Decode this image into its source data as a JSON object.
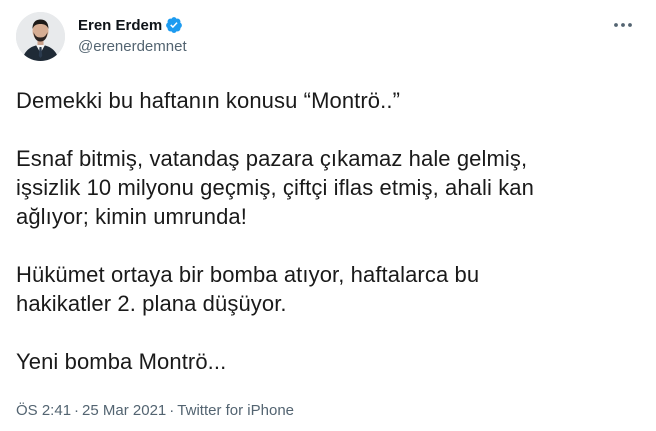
{
  "author": {
    "display_name": "Eren Erdem",
    "handle": "@erenerdemnet",
    "verified": true,
    "avatar_icon": "profile-photo-avatar"
  },
  "tweet": {
    "paragraphs": [
      "Demekki bu haftanın konusu “Montrö..”",
      "Esnaf bitmiş, vatandaş pazara çıkamaz hale gelmiş,\nişsizlik 10 milyonu geçmiş, çiftçi iflas etmiş, ahali kan\nağlıyor; kimin umrunda!",
      "Hükümet ortaya bir bomba atıyor, haftalarca bu\nhakikatler 2. plana düşüyor.",
      "Yeni bomba Montrö..."
    ]
  },
  "meta": {
    "time": "ÖS 2:41",
    "date": "25 Mar 2021",
    "source": "Twitter for iPhone",
    "separator": "·"
  },
  "colors": {
    "verified_badge": "#1d9bf0",
    "secondary_text": "#536471",
    "primary_text": "#0f1419"
  },
  "icons": {
    "verified": "verified-badge-icon",
    "more": "more-options-icon"
  }
}
